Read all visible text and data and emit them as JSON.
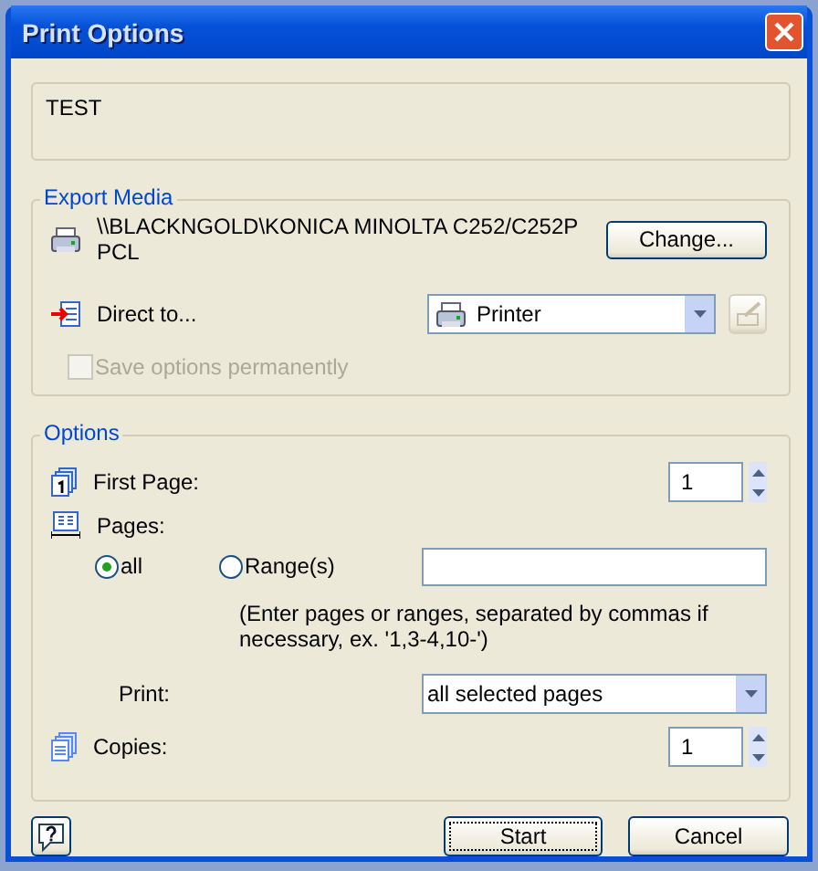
{
  "window": {
    "title": "Print Options"
  },
  "note": {
    "text": "TEST"
  },
  "export_media": {
    "legend": "Export Media",
    "printer": "\\\\BLACKNGOLD\\KONICA MINOLTA C252/C252P PCL",
    "change_button": "Change...",
    "direct_to_label": "Direct to...",
    "destination": "Printer",
    "save_option": {
      "label": "Save options permanently",
      "checked": false,
      "disabled": true
    }
  },
  "options": {
    "legend": "Options",
    "first_page_label": "First Page:",
    "first_page": "1",
    "pages_label": "Pages:",
    "page_choices": [
      {
        "label": "all",
        "selected": true
      },
      {
        "label": "Range(s)",
        "selected": false
      }
    ],
    "hint": "(Enter pages or ranges, separated by commas if necessary, ex. '1,3-4,10-')",
    "print_label": "Print:",
    "print_value": "all selected pages",
    "copies_label": "Copies:",
    "copies": "1"
  },
  "buttons": {
    "start": "Start",
    "cancel": "Cancel"
  }
}
